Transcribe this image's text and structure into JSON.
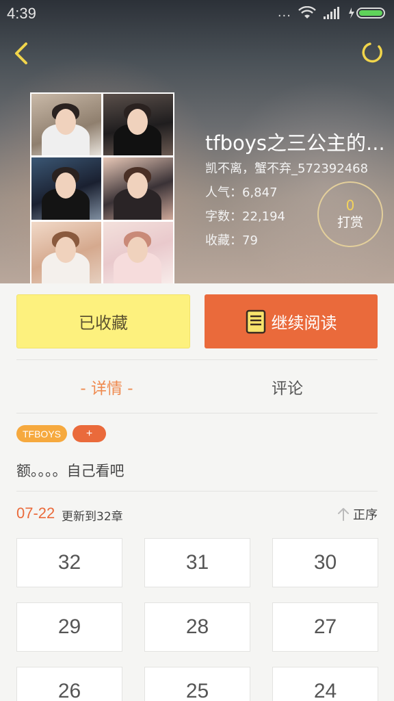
{
  "status_bar": {
    "time": "4:39",
    "dots": "..."
  },
  "book": {
    "title": "tfboys之三公主的...",
    "author": "凯不离，蟹不弃_572392468",
    "popularity": "人气：6,847",
    "word_count": "字数：22,194",
    "favorites": "收藏：79"
  },
  "tip": {
    "count": "0",
    "label": "打赏"
  },
  "actions": {
    "favorited_label": "已收藏",
    "continue_label": "继续阅读"
  },
  "tabs": {
    "detail": "- 详情 -",
    "comments": "评论"
  },
  "tags": [
    "TFBOYS",
    "+"
  ],
  "description": "额。。。。自己看吧",
  "update": {
    "date": "07-22",
    "text": "更新到32章",
    "sort_label": "正序"
  },
  "chapters": [
    "32",
    "31",
    "30",
    "29",
    "28",
    "27",
    "26",
    "25",
    "24"
  ],
  "colors": {
    "accent_orange": "#ea6a3b",
    "favorite_yellow": "#fdf17e",
    "tab_active": "#ef8a4f",
    "tag_orange": "#f6a93e"
  }
}
